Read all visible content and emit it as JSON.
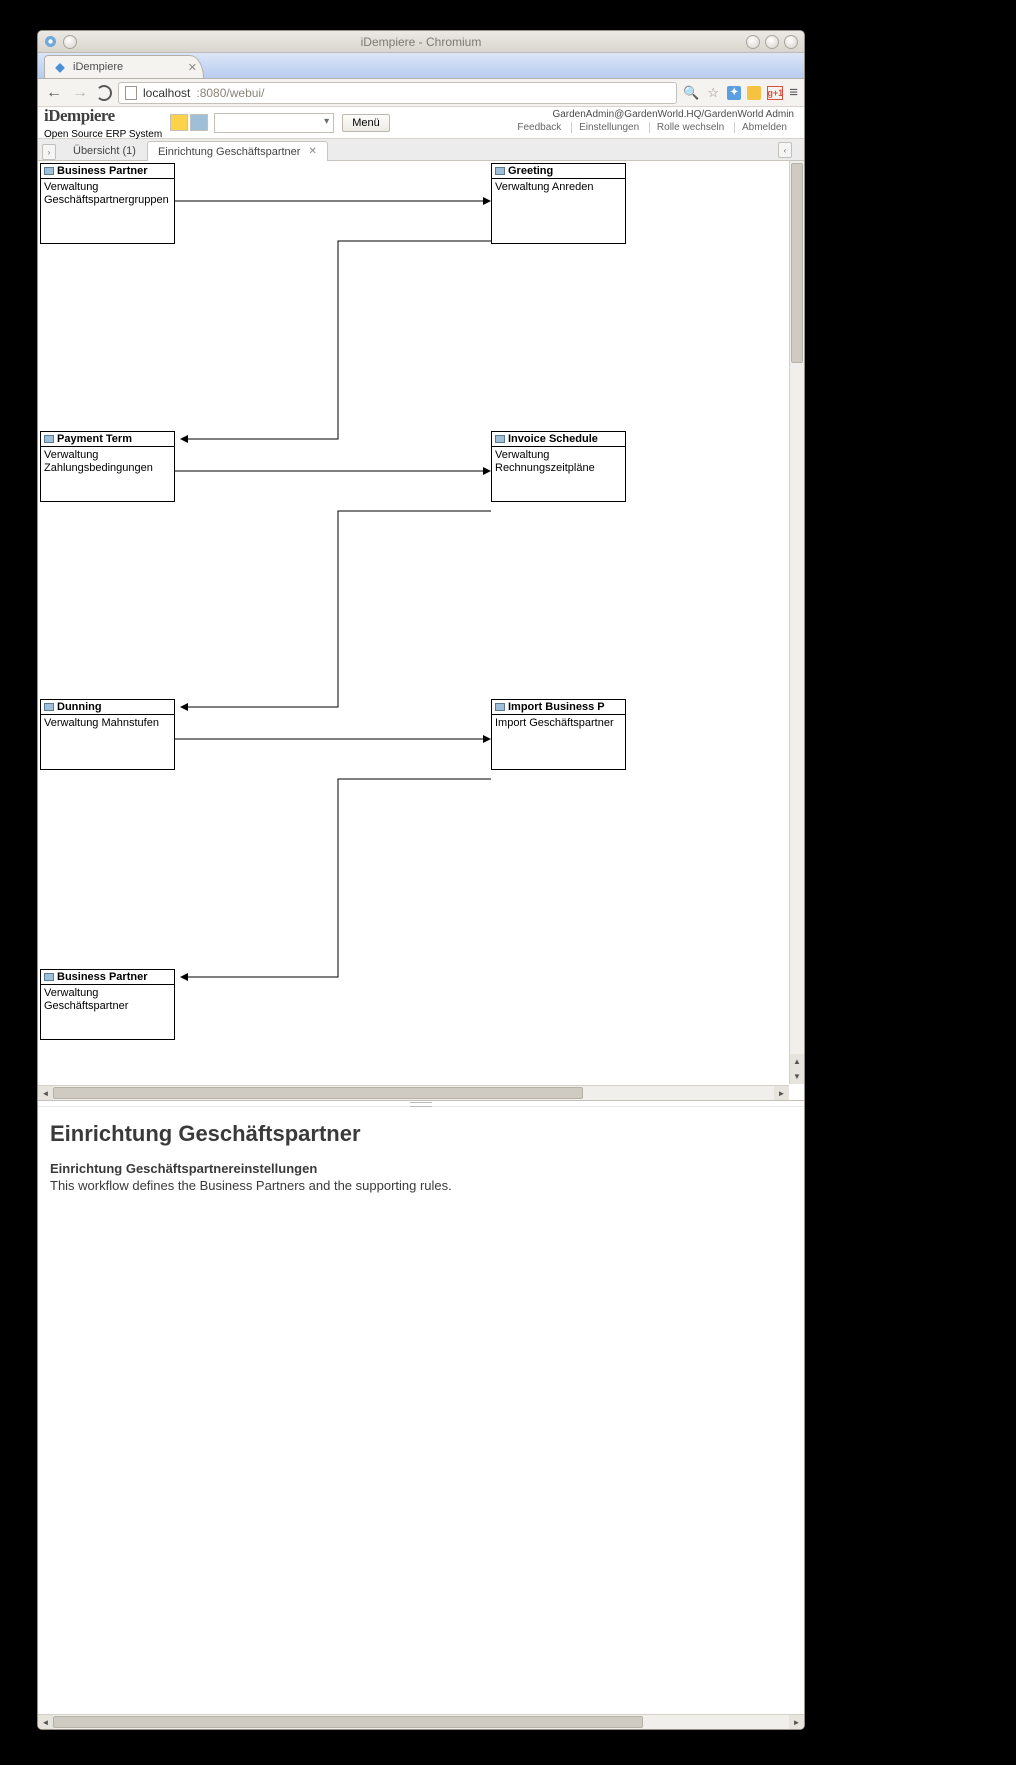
{
  "window": {
    "title": "iDempiere - Chromium"
  },
  "browser": {
    "tab_label": "iDempiere",
    "url_host": "localhost",
    "url_path": ":8080/webui/"
  },
  "app": {
    "logo_main": "iDempiere",
    "logo_sub": "Open Source  ERP System",
    "menu_button": "Menü",
    "user_line": "GardenAdmin@GardenWorld.HQ/GardenWorld Admin",
    "links": {
      "feedback": "Feedback",
      "settings": "Einstellungen",
      "switch_role": "Rolle wechseln",
      "logout": "Abmelden"
    }
  },
  "apptabs": {
    "overview": "Übersicht (1)",
    "current": "Einrichtung Geschäftspartner"
  },
  "nodes": {
    "bp_group": {
      "title": "Business Partner",
      "desc": "Verwaltung Geschäftspartnergruppen"
    },
    "greeting": {
      "title": "Greeting",
      "desc": "Verwaltung      Anreden"
    },
    "payment_term": {
      "title": "Payment Term",
      "desc": "Verwaltung Zahlungsbedingungen"
    },
    "invoice_schedule": {
      "title": "Invoice Schedule",
      "desc": "Verwaltung Rechnungszeitpläne"
    },
    "dunning": {
      "title": "Dunning",
      "desc": "Verwaltung Mahnstufen"
    },
    "import_bp": {
      "title": "Import Business P",
      "desc": "Import Geschäftspartner"
    },
    "business_partner": {
      "title": "Business Partner",
      "desc": "Verwaltung Geschäftspartner"
    }
  },
  "detail": {
    "heading": "Einrichtung Geschäftspartner",
    "subtitle": "Einrichtung Geschäftspartnereinstellungen",
    "description": "This workflow defines the Business Partners and the supporting rules."
  }
}
